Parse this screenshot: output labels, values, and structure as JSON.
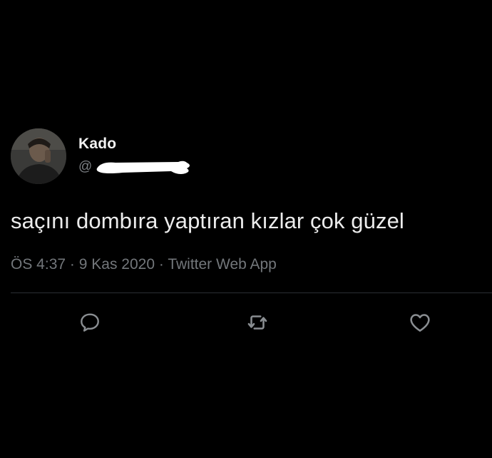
{
  "tweet": {
    "author": {
      "display_name": "Kado",
      "handle_prefix": "@"
    },
    "text": "saçını dombıra yaptıran kızlar çok güzel",
    "meta": {
      "time": "ÖS 4:37",
      "separator": "·",
      "date": "9 Kas 2020",
      "source": "Twitter Web App"
    },
    "actions": [
      {
        "name": "reply",
        "icon": "speech-bubble-icon"
      },
      {
        "name": "retweet",
        "icon": "retweet-arrows-icon"
      },
      {
        "name": "like",
        "icon": "heart-icon"
      }
    ]
  },
  "colors": {
    "background": "#000000",
    "primary_text": "#ececec",
    "secondary_text": "#73777b",
    "divider": "#2b2f33",
    "icon": "#8a8e92",
    "redaction": "#ffffff"
  }
}
